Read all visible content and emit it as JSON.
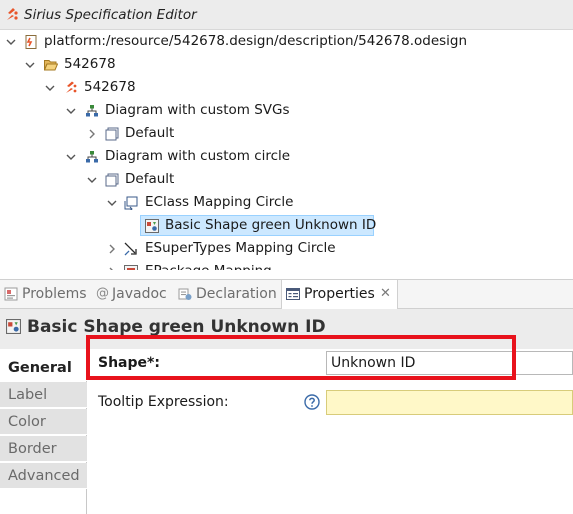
{
  "editor": {
    "title": "Sirius Specification Editor"
  },
  "tree": {
    "items": [
      {
        "label": "platform:/resource/542678.design/description/542678.odesign",
        "icon": "odesign-file-icon"
      },
      {
        "label": "542678",
        "icon": "folder-open-icon"
      },
      {
        "label": "542678",
        "icon": "sirius-viewpoint-icon"
      },
      {
        "label": "Diagram with custom SVGs",
        "icon": "diagram-description-icon"
      },
      {
        "label": "Default",
        "icon": "layer-icon"
      },
      {
        "label": "Diagram with custom circle",
        "icon": "diagram-description-icon"
      },
      {
        "label": "Default",
        "icon": "layer-icon"
      },
      {
        "label": "EClass Mapping Circle",
        "icon": "node-mapping-icon"
      },
      {
        "label": "Basic Shape green Unknown ID",
        "icon": "basic-shape-icon"
      },
      {
        "label": "ESuperTypes Mapping Circle",
        "icon": "edge-mapping-icon"
      },
      {
        "label": "EPackage Mapping",
        "icon": "container-mapping-icon"
      }
    ]
  },
  "views": {
    "tabs": [
      {
        "label": "Problems",
        "icon": "problems-icon",
        "active": false
      },
      {
        "label": "Javadoc",
        "icon": "at-icon",
        "active": false
      },
      {
        "label": "Declaration",
        "icon": "declaration-icon",
        "active": false
      },
      {
        "label": "Properties",
        "icon": "properties-icon",
        "active": true
      }
    ],
    "close_glyph": "✕"
  },
  "properties": {
    "title": "Basic Shape green Unknown ID",
    "categories": [
      {
        "label": "General",
        "active": true
      },
      {
        "label": "Label",
        "active": false
      },
      {
        "label": "Color",
        "active": false
      },
      {
        "label": "Border",
        "active": false
      },
      {
        "label": "Advanced",
        "active": false
      }
    ],
    "fields": {
      "shape_label": "Shape*:",
      "shape_value": "Unknown ID",
      "tooltip_label": "Tooltip Expression:",
      "tooltip_value": ""
    }
  },
  "colors": {
    "selection": "#cce8ff",
    "highlight": "#e8121c",
    "sirius_orange": "#e8552a",
    "tooltip_bg": "#fff8c8"
  }
}
